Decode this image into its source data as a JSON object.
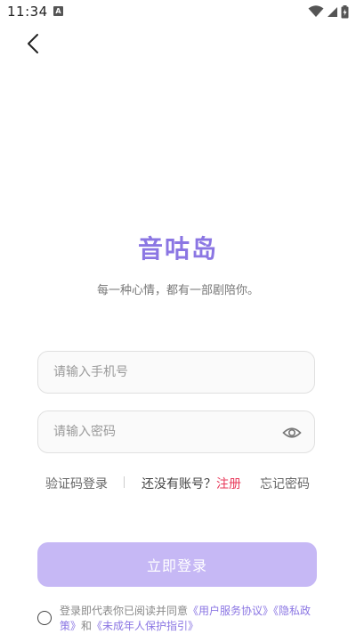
{
  "status_bar": {
    "time": "11:34",
    "notification_icon": "a-notification-icon",
    "wifi_icon": "wifi-icon",
    "signal_icon": "signal-icon",
    "battery_icon": "battery-icon"
  },
  "nav": {
    "back_icon": "chevron-left-icon"
  },
  "header": {
    "app_name": "音咕岛",
    "slogan": "每一种心情，都有一部剧陪你。"
  },
  "form": {
    "phone_placeholder": "请输入手机号",
    "phone_value": "",
    "password_placeholder": "请输入密码",
    "password_value": "",
    "eye_icon": "eye-icon"
  },
  "links": {
    "code_login": "验证码登录",
    "no_account": "还没有账号？",
    "register": "注册",
    "forgot_password": "忘记密码"
  },
  "actions": {
    "login_label": "立即登录"
  },
  "agreement": {
    "prefix": "登录即代表你已阅读并同意",
    "user_agreement": "《用户服务协议》",
    "privacy_policy": "《隐私政策》",
    "and": "和",
    "minor_guide": "《未成年人保护指引》"
  },
  "colors": {
    "brand": "#8b76e3",
    "button_disabled": "#c6b8f5",
    "register": "#e8395a"
  }
}
